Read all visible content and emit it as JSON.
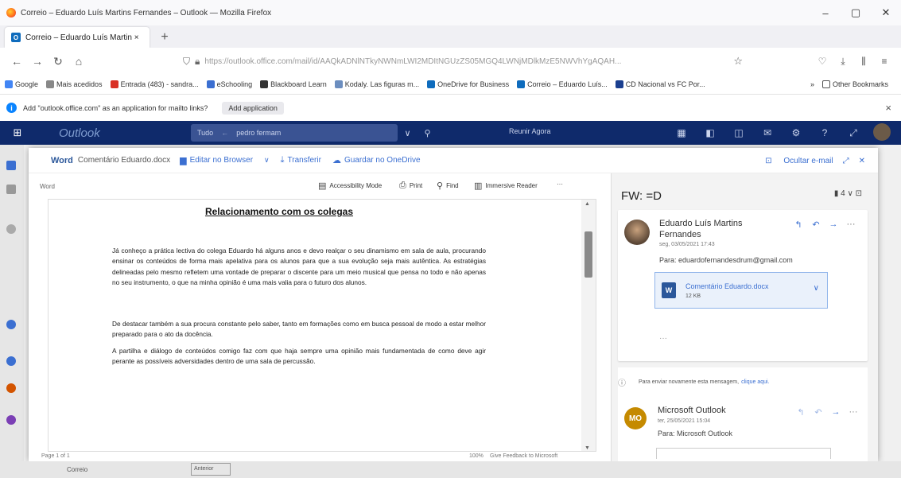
{
  "window": {
    "title": "Correio – Eduardo Luís Martins Fernandes – Outlook — Mozilla Firefox",
    "controls": [
      "–",
      "▢",
      "✕"
    ]
  },
  "tabs": [
    {
      "title": "Correio – Eduardo Luís Martin ×",
      "close": "×"
    }
  ],
  "newtab_label": "+",
  "nav": {
    "back": "←",
    "forward": "→",
    "reload": "↻",
    "home": "⌂",
    "url": "https://outlook.office.com/mail/id/AAQkADNlNTkyNWNmLWI2MDItNGUzZS05MGQ4LWNjMDlkMzE5NWVhYgAQAH...",
    "right_icons": [
      "♡",
      "⤓",
      "⫼",
      "≡"
    ]
  },
  "bookmarks": {
    "items": [
      {
        "label": "Google",
        "color": "#4285f4"
      },
      {
        "label": "Mais acedidos",
        "color": "#888888"
      },
      {
        "label": "Entrada (483) - sandra...",
        "color": "#d93025"
      },
      {
        "label": "eSchooling",
        "color": "#3b6fd1"
      },
      {
        "label": "Blackboard Learn",
        "color": "#333333"
      },
      {
        "label": "Kodaly. Las figuras m...",
        "color": "#6c8ebf"
      },
      {
        "label": "OneDrive for Business",
        "color": "#0f6cbd"
      },
      {
        "label": "Correio – Eduardo Luís...",
        "color": "#0f6cbd"
      },
      {
        "label": "CD Nacional vs FC Por...",
        "color": "#1a3f8f"
      }
    ],
    "overflow": "»",
    "other": "Other Bookmarks"
  },
  "notification": {
    "text": "Add \"outlook.office.com\" as an application for mailto links?",
    "button": "Add application",
    "close": "×"
  },
  "owa": {
    "brand": "Outlook",
    "search_scope": "Tudo",
    "search_query": "pedro fermam",
    "meeting": "Reunir Agora",
    "tools": [
      "▦",
      "◧",
      "◫",
      "✉",
      "⚙",
      "?",
      "⤢"
    ]
  },
  "dialog": {
    "app": "Word",
    "doc_name": "Comentário Eduardo.docx",
    "edit_browser": "Editar no Browser",
    "transfer": "Transferir",
    "save_onedrive": "Guardar no OneDrive",
    "hide_email": "Ocultar e-mail",
    "viewer_label": "Word",
    "toolbar": {
      "accessibility": "Accessibility Mode",
      "print": "Print",
      "find": "Find",
      "immersive": "Immersive Reader",
      "more": "···"
    },
    "status": {
      "page": "Page 1 of 1",
      "zoom": "100%",
      "feedback": "Give Feedback to Microsoft"
    }
  },
  "document": {
    "heading": "Relacionamento com os colegas",
    "paragraphs": [
      "Já conheço a prática lectiva do colega Eduardo há alguns anos e devo realçar o seu dinamismo em sala de aula, procurando ensinar os conteúdos de forma mais apelativa para os alunos para que a sua evolução seja mais autêntica. As estratégias delineadas pelo mesmo refletem uma vontade de preparar o discente para um meio musical que pensa no todo e não apenas no seu instrumento, o que na minha opinião é uma mais valia para o futuro dos alunos.",
      "De destacar também a sua procura constante pelo saber, tanto em formações como em busca pessoal de modo a estar melhor preparado para o ato da docência.",
      "A partilha e diálogo de conteúdos comigo faz com que haja sempre uma opinião mais fundamentada de como deve agir perante as possíveis adversidades dentro de uma sala de percussão."
    ]
  },
  "reading": {
    "subject": "FW: =D",
    "subject_tools": "▮ 4 ∨  ⊡",
    "message1": {
      "sender": "Eduardo Luís Martins Fernandes",
      "date": "seg, 03/05/2021 17:43",
      "to": "Para: eduardofernandesdrum@gmail.com",
      "attachment_name": "Comentário Eduardo.docx",
      "attachment_size": "12 KB",
      "more": "···"
    },
    "notice_text": "Para enviar novamente esta mensagem,",
    "notice_link": "clique aqui.",
    "message2": {
      "initials": "MO",
      "sender": "Microsoft Outlook",
      "date": "ter, 25/05/2021 15:04",
      "to": "Para: Microsoft Outlook"
    }
  },
  "bottom": {
    "folder": "Correio",
    "chip": "Anterior"
  }
}
